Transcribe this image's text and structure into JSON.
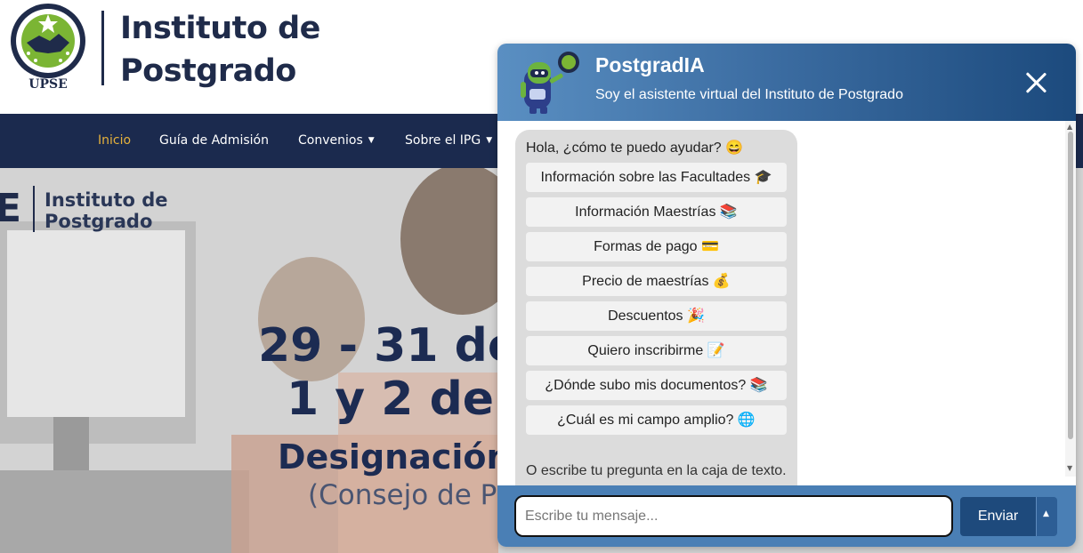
{
  "site": {
    "seal_caption": "UPSE",
    "logo_line1": "Instituto de",
    "logo_line2": "Postgrado",
    "nav": [
      {
        "label": "Inicio"
      },
      {
        "label": "Guía de Admisión"
      },
      {
        "label": "Convenios"
      },
      {
        "label": "Sobre el IPG"
      }
    ],
    "accent_color": "#e6b23c",
    "nav_color": "#1b2a4e"
  },
  "hero": {
    "logo_letter": "E",
    "logo_line1": "Instituto de",
    "logo_line2": "Postgrado",
    "line1": "29 - 31 de",
    "line2": "1 y 2 de",
    "line3": "Designación",
    "line4": "(Consejo de P"
  },
  "chat": {
    "title": "PostgradIA",
    "subtitle": "Soy el asistente virtual del Instituto de Postgrado",
    "close_icon": "close-icon",
    "greeting": "Hola, ¿cómo te puedo ayudar? 😄",
    "options": [
      {
        "label": "Información sobre las Facultades 🎓"
      },
      {
        "label": "Información Maestrías 📚"
      },
      {
        "label": "Formas de pago 💳"
      },
      {
        "label": "Precio de maestrías 💰"
      },
      {
        "label": "Descuentos 🎉"
      },
      {
        "label": "Quiero inscribirme 📝"
      },
      {
        "label": "¿Dónde subo mis documentos? 📚"
      },
      {
        "label": "¿Cuál es mi campo amplio? 🌐"
      }
    ],
    "footer_text": "O escribe tu pregunta en la caja de texto.",
    "input_placeholder": "Escribe tu mensaje...",
    "send_label": "Enviar",
    "header_color": "#3d6ea3",
    "send_color": "#1e4a7c"
  }
}
